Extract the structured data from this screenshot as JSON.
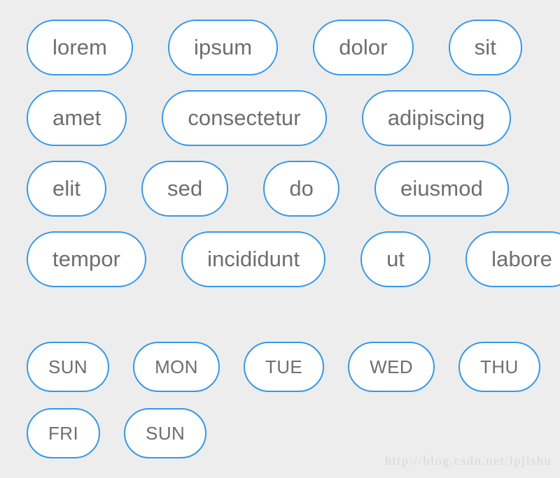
{
  "theme": {
    "background": "#ededed",
    "chip_fill": "#ffffff",
    "chip_border": "#3498e8",
    "chip_text": "#6e6e6e",
    "watermark_text": "#d8d7d3"
  },
  "words_section": {
    "rows": [
      {
        "chips": [
          {
            "label": "lorem"
          },
          {
            "label": "ipsum"
          },
          {
            "label": "dolor"
          },
          {
            "label": "sit"
          }
        ]
      },
      {
        "chips": [
          {
            "label": "amet"
          },
          {
            "label": "consectetur"
          },
          {
            "label": "adipiscing"
          }
        ]
      },
      {
        "chips": [
          {
            "label": "elit"
          },
          {
            "label": "sed"
          },
          {
            "label": "do"
          },
          {
            "label": "eiusmod"
          }
        ]
      },
      {
        "chips": [
          {
            "label": "tempor"
          },
          {
            "label": "incididunt"
          },
          {
            "label": "ut"
          },
          {
            "label": "labore"
          }
        ]
      }
    ]
  },
  "weekdays_section": {
    "rows": [
      {
        "chips": [
          {
            "label": "SUN"
          },
          {
            "label": "MON"
          },
          {
            "label": "TUE"
          },
          {
            "label": "WED"
          },
          {
            "label": "THU"
          }
        ]
      },
      {
        "chips": [
          {
            "label": "FRI"
          },
          {
            "label": "SUN"
          }
        ]
      }
    ]
  },
  "watermark": {
    "text": "http://blog.csdn.net/lpjishu"
  }
}
